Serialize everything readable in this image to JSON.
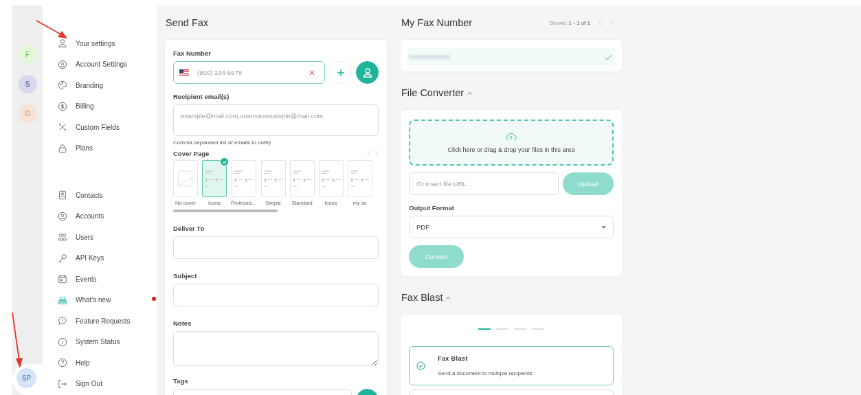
{
  "rail": {
    "workspaces": [
      {
        "initial": "F",
        "color": "#e2f6d8"
      },
      {
        "initial": "S",
        "color": "#d8d8ec"
      },
      {
        "initial": "D",
        "color": "#f7e2d6"
      }
    ],
    "user": {
      "initials": "SP"
    }
  },
  "menu": {
    "groups": [
      [
        {
          "label": "Your settings",
          "highlight": false,
          "dot": false
        },
        {
          "label": "Account Settings",
          "highlight": false,
          "dot": false
        },
        {
          "label": "Branding",
          "highlight": false,
          "dot": false
        },
        {
          "label": "Billing",
          "highlight": false,
          "dot": false
        },
        {
          "label": "Custom Fields",
          "highlight": false,
          "dot": false
        },
        {
          "label": "Plans",
          "highlight": false,
          "dot": false
        }
      ],
      [
        {
          "label": "Contacts",
          "highlight": false,
          "dot": false
        },
        {
          "label": "Accounts",
          "highlight": false,
          "dot": false
        },
        {
          "label": "Users",
          "highlight": false,
          "dot": false
        },
        {
          "label": "API Keys",
          "highlight": false,
          "dot": false
        },
        {
          "label": "Events",
          "highlight": false,
          "dot": false
        },
        {
          "label": "What's new",
          "highlight": true,
          "dot": true
        },
        {
          "label": "Feature Requests",
          "highlight": false,
          "dot": false
        },
        {
          "label": "System Status",
          "highlight": false,
          "dot": false
        },
        {
          "label": "Help",
          "highlight": false,
          "dot": false
        },
        {
          "label": "Sign Out",
          "highlight": false,
          "dot": false
        }
      ]
    ]
  },
  "send_fax": {
    "title": "Send Fax",
    "fax_number": {
      "label": "Fax Number",
      "placeholder": "(500) 234-5678"
    },
    "recipients": {
      "label": "Recipient email(s)",
      "placeholder": "example@mail.com,onemoreexample@mail.com",
      "hint": "Comma separated list of emails to notify"
    },
    "cover_page": {
      "label": "Cover Page",
      "pages": [
        {
          "label": "No cover",
          "kind": "blank",
          "selected": false
        },
        {
          "label": "Icons",
          "kind": "doc",
          "selected": true
        },
        {
          "label": "Professio...",
          "kind": "doc",
          "selected": false
        },
        {
          "label": "Simple",
          "kind": "doc",
          "selected": false
        },
        {
          "label": "Standard",
          "kind": "doc",
          "selected": false
        },
        {
          "label": "Icons",
          "kind": "doc",
          "selected": false
        },
        {
          "label": "my ac",
          "kind": "doc",
          "selected": false
        }
      ]
    },
    "deliver_to": {
      "label": "Deliver To"
    },
    "subject": {
      "label": "Subject"
    },
    "notes": {
      "label": "Notes"
    },
    "tags": {
      "label": "Tags"
    }
  },
  "my_fax_number": {
    "title": "My Fax Number",
    "pager": {
      "prefix": "Shows:",
      "range": "1 - 1 of 1"
    }
  },
  "file_converter": {
    "title": "File Converter",
    "expanded": true,
    "dropzone": "Click here or drag & drop your files in this area",
    "url": {
      "placeholder": "Or insert file URL"
    },
    "upload": "Upload",
    "output_format": {
      "label": "Output Format",
      "value": "PDF"
    },
    "convert": "Convert"
  },
  "fax_blast": {
    "title": "Fax Blast",
    "expanded": true,
    "steps": [
      {
        "selected": true
      },
      {
        "selected": false
      },
      {
        "selected": false
      },
      {
        "selected": false
      }
    ],
    "option": {
      "title": "Fax Blast",
      "description": "Send a document to multiple recipients",
      "selected": true
    }
  }
}
